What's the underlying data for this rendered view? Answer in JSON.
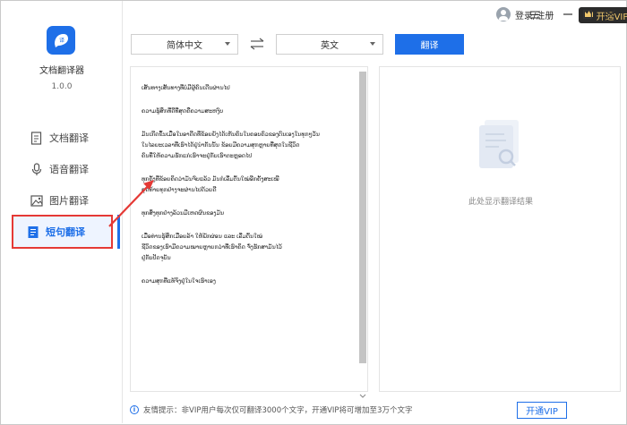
{
  "app": {
    "name": "文档翻译器",
    "version": "1.0.0",
    "accent": "#1e6fe8",
    "highlight": "#e53935"
  },
  "header": {
    "login_label": "登录/注册",
    "vip_label": "开通VIP",
    "window_controls": [
      "menu-icon",
      "minimize-icon",
      "maximize-icon",
      "close-icon"
    ]
  },
  "sidebar": {
    "items": [
      {
        "label": "文档翻译",
        "icon": "document-icon",
        "active": false
      },
      {
        "label": "语音翻译",
        "icon": "microphone-icon",
        "active": false
      },
      {
        "label": "图片翻译",
        "icon": "image-icon",
        "active": false
      },
      {
        "label": "短句翻译",
        "icon": "text-note-icon",
        "active": true
      }
    ]
  },
  "toolbar": {
    "source_lang": "简体中文",
    "target_lang": "英文",
    "translate_label": "翻译"
  },
  "source": {
    "paragraphs": [
      "ເສັ້ນທາງເສັ້ນທາງທີ່ບໍ່ມີຜູ້ຄົນເດີນຜ່ານໄປ",
      "ຄວາມຮູ້ສຶກທີ່ດີທີ່ສຸດຄືຄວາມສະຫງົບ",
      "ມັນເກີດຂຶ້ນເມື່ອໃນອາດີດທີ່ຂ້ອຍຍັງໄດ້ເຫັນຄົນໃນຄອບຄົວຂອງຕົນເອງໃນທຸກໆວັນ\nໃນໄລຍະເວລາທີ່ເຮົາໄດ້ຢູ່ນຳກັນນັ້ນ ຂ້ອຍມີຄວາມສຸກຫຼາຍທີ່ສຸດໃນຊີວິດ\nຄົນທີ່ໃຫ້ຄວາມຮັກແກ່ເຮົາຈະຢູ່ກັບເຮົາຕະຫຼອດໄປ",
      "ທຸກຄັ້ງທີ່ຂ້ອຍຄິດວ່າມັນຈົບແລ້ວ ມັນກໍເລີ່ມຕົ້ນໃໝ່ອີກຄັ້ງສະເໝີ\nສຸດທ້າຍທຸກຢ່າງຈະຜ່ານໄປດ້ວຍດີ",
      "ທຸກສິ່ງທຸກຢ່າງລ້ວນມີເຫດຜົນຂອງມັນ",
      "ເມື່ອທ່ານຮູ້ສຶກເມື່ອຍລ້າ ໃຫ້ພັກຜ່ອນ ແລະ ເລີ່ມຕົ້ນໃໝ່\nຊີວິດຂອງເຮົາມີຄວາມໝາຍຫຼາຍກວ່າທີ່ເຮົາຄິດ ຈົ່ງຮັກສາມັນໄວ້\nຢູ່ກັບປັດຈຸບັນ",
      "ຄວາມສຸກທີ່ແທ້ຈິງຢູ່ໃນໃຈເຮົາເອງ"
    ]
  },
  "result": {
    "empty_text": "此处显示翻译结果"
  },
  "footer": {
    "tip_label": "友情提示：",
    "tip_text": "非VIP用户每次仅可翻译3000个文字，开通VIP将可增加至3万个文字",
    "vip_label": "开通VIP"
  }
}
